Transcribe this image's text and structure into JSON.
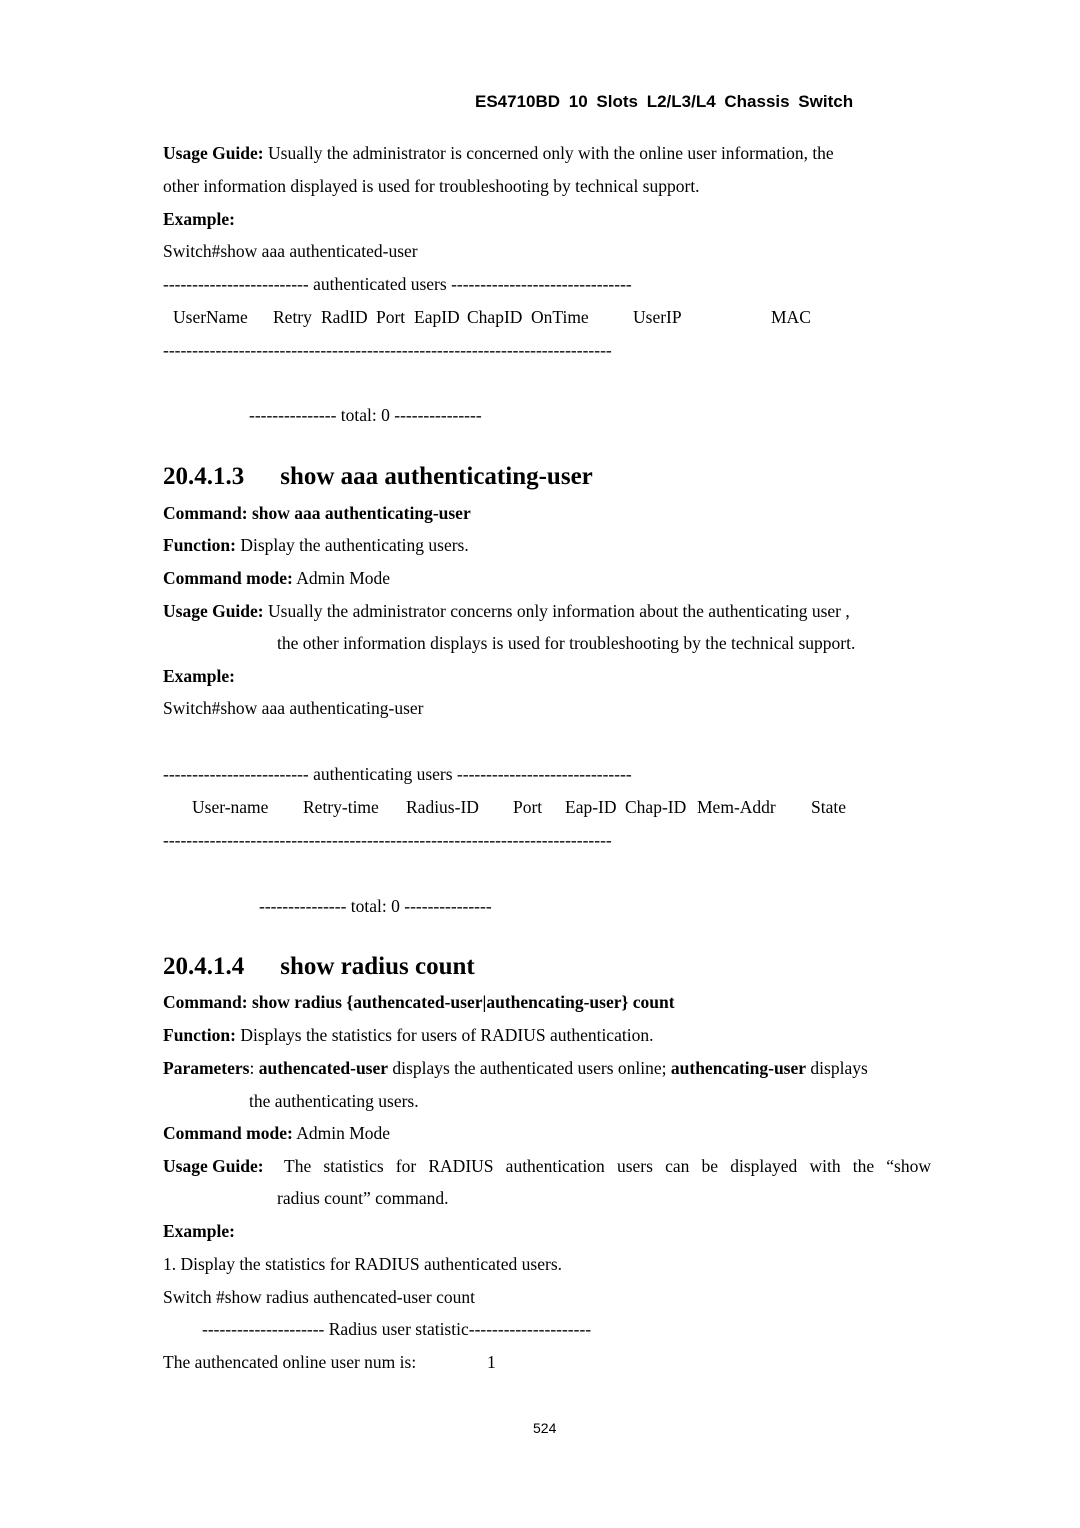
{
  "header": {
    "title": "ES4710BD 10 Slots L2/L3/L4 Chassis Switch"
  },
  "prev_section": {
    "usage_label": "Usage Guide:",
    "usage_line1": " Usually the administrator is concerned only with the online user information, the",
    "usage_line2": "other information displayed is used for troubleshooting by technical support.",
    "example_label": "Example:",
    "cmd": "Switch#show aaa authenticated-user",
    "banner": "------------------------- authenticated users -------------------------------",
    "columns": [
      "UserName",
      "Retry",
      "RadID",
      "Port",
      "EapID",
      "ChapID",
      "OnTime",
      "UserIP",
      "MAC"
    ],
    "separator": "-----------------------------------------------------------------------------",
    "total": "--------------- total: 0 ---------------"
  },
  "section_1": {
    "number": "20.4.1.3",
    "title": "show aaa authenticating-user",
    "command_label": "Command: show aaa authenticating-user",
    "function_label": "Function:",
    "function_text": " Display the authenticating users.",
    "mode_label": "Command mode:",
    "mode_text": " Admin Mode",
    "usage_label": "Usage Guide:",
    "usage_line1": " Usually the administrator concerns only information about the authenticating user ,",
    "usage_line2": "the other information displays is used for troubleshooting by the technical support.",
    "example_label": "Example:",
    "cmd": "Switch#show aaa authenticating-user",
    "banner": "------------------------- authenticating users ------------------------------",
    "columns": [
      "User-name",
      "Retry-time",
      "Radius-ID",
      "Port",
      "Eap-ID",
      "Chap-ID",
      "Mem-Addr",
      "State"
    ],
    "separator": "-----------------------------------------------------------------------------",
    "total": "--------------- total: 0 ---------------"
  },
  "section_2": {
    "number": "20.4.1.4",
    "title": "show radius count",
    "command_label": "Command: show radius {authencated-user|authencating-user} count",
    "function_label": "Function:",
    "function_text": " Displays the statistics for users of RADIUS authentication.",
    "params_label": "Parameters",
    "params_colon": ": ",
    "param1": "authencated-user",
    "param1_text": " displays the authenticated users online; ",
    "param2": "authencating-user",
    "param2_text": " displays",
    "params_line2": "the authenticating users.",
    "mode_label": "Command mode:",
    "mode_text": " Admin Mode",
    "usage_label": "Usage Guide:",
    "usage_line1": "The statistics for RADIUS authentication users can be displayed with the “show",
    "usage_line2": "radius count” command.",
    "example_label": "Example:",
    "step1": "1. Display the statistics for RADIUS authenticated users.",
    "cmd": "Switch #show radius authencated-user count",
    "banner": "--------------------- Radius user statistic---------------------",
    "result_label": "The authencated online user num is:",
    "result_value": "1"
  },
  "footer": {
    "page_number": "524"
  }
}
